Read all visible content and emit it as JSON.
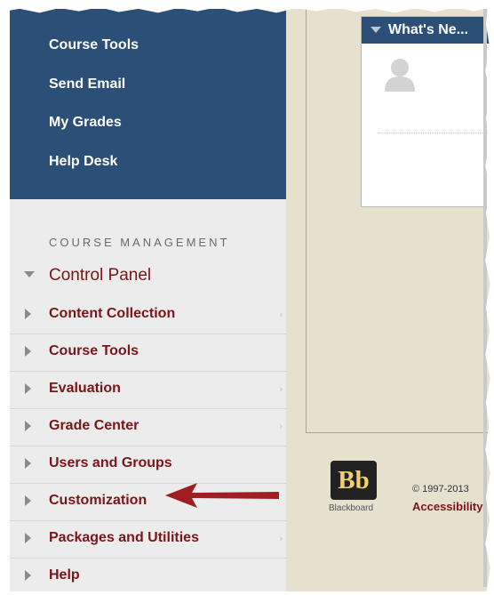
{
  "course_tools_panel": {
    "links": [
      "Course Tools",
      "Send Email",
      "My Grades",
      "Help Desk"
    ]
  },
  "course_management": {
    "heading": "COURSE MANAGEMENT",
    "control_panel": "Control Panel",
    "items": [
      {
        "label": "Content Collection",
        "has_submenu": true
      },
      {
        "label": "Course Tools",
        "has_submenu": false
      },
      {
        "label": "Evaluation",
        "has_submenu": true
      },
      {
        "label": "Grade Center",
        "has_submenu": true
      },
      {
        "label": "Users and Groups",
        "has_submenu": false
      },
      {
        "label": "Customization",
        "has_submenu": false
      },
      {
        "label": "Packages and Utilities",
        "has_submenu": true
      },
      {
        "label": "Help",
        "has_submenu": false
      }
    ]
  },
  "whats_new_widget": {
    "title": "What's Ne..."
  },
  "footer": {
    "logo_text": "Bb",
    "logo_caption": "Blackboard",
    "copyright": "© 1997-2013",
    "accessibility_link": "Accessibility"
  },
  "colors": {
    "nav_blue": "#2c4f78",
    "nav_label_red": "#7a1518",
    "annotation_arrow": "#a01d22",
    "content_bg": "#e6e0cf"
  },
  "icons": {
    "avatar": "person-silhouette-icon",
    "expand": "triangle-right-icon",
    "collapse": "triangle-down-icon",
    "annotation": "red-arrow-left-icon"
  }
}
